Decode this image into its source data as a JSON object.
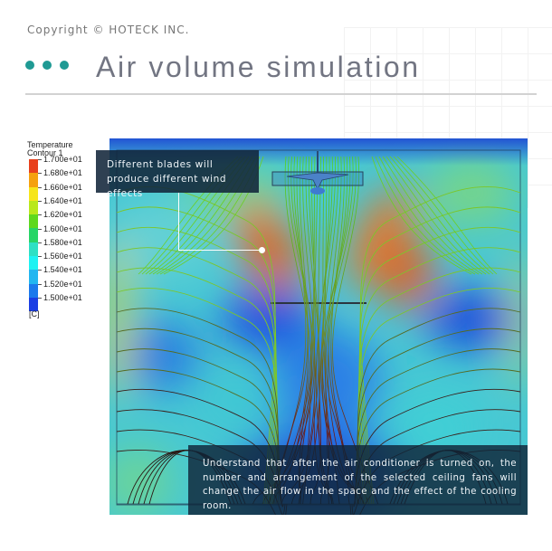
{
  "header": {
    "copyright": "Copyright © HOTECK INC.",
    "title": "Air volume simulation",
    "accent_color": "#1f9a94",
    "title_color": "#727582"
  },
  "legend": {
    "title_line1": "Temperature",
    "title_line2": "Contour 1",
    "unit": "[C]",
    "labels": [
      "1.700e+01",
      "1.680e+01",
      "1.660e+01",
      "1.640e+01",
      "1.620e+01",
      "1.600e+01",
      "1.580e+01",
      "1.560e+01",
      "1.540e+01",
      "1.520e+01",
      "1.500e+01"
    ],
    "colors": [
      "#e8401c",
      "#f5a10f",
      "#f6e51b",
      "#b9e81c",
      "#5ed81e",
      "#27d566",
      "#2ee0c4",
      "#1df2f2",
      "#22b6f0",
      "#1b79ec",
      "#1a3ee4"
    ]
  },
  "simulation": {
    "name": "temperature-contour-streamlines",
    "palette": {
      "cold": "#1d55d6",
      "cool": "#45c6d8",
      "mild": "#6dd58a",
      "warm": "#d2892f",
      "hot": "#dd5a2b"
    }
  },
  "callouts": {
    "top": "Different blades will produce different wind effects",
    "bottom": "Understand that after the air conditioner is turned on, the number and arrangement of the selected ceiling fans will change the air flow in the space and the effect of the cooling room."
  }
}
